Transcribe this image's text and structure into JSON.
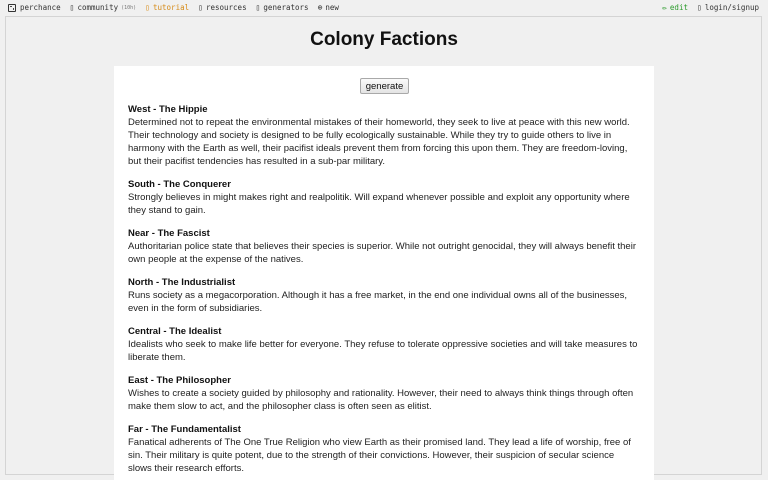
{
  "nav": {
    "site": "perchance",
    "community": "community",
    "community_count": "(10h)",
    "tutorial": "tutorial",
    "resources": "resources",
    "generators": "generators",
    "new": "new",
    "edit": "edit",
    "login": "login/signup"
  },
  "page": {
    "title": "Colony Factions",
    "generate_label": "generate"
  },
  "factions": [
    {
      "name": "West - The Hippie",
      "desc": "Determined not to repeat the environmental mistakes of their homeworld, they seek to live at peace with this new world. Their technology and society is designed to be fully ecologically sustainable. While they try to guide others to live in harmony with the Earth as well, their pacifist ideals prevent them from forcing this upon them. They are freedom-loving, but their pacifist tendencies has resulted in a sub-par military."
    },
    {
      "name": "South - The Conquerer",
      "desc": "Strongly believes in might makes right and realpolitik. Will expand whenever possible and exploit any opportunity where they stand to gain."
    },
    {
      "name": "Near - The Fascist",
      "desc": "Authoritarian police state that believes their species is superior. While not outright genocidal, they will always benefit their own people at the expense of the natives."
    },
    {
      "name": "North - The Industrialist",
      "desc": "Runs society as a megacorporation. Although it has a free market, in the end one individual owns all of the businesses, even in the form of subsidiaries."
    },
    {
      "name": "Central - The Idealist",
      "desc": "Idealists who seek to make life better for everyone. They refuse to tolerate oppressive societies and will take measures to liberate them."
    },
    {
      "name": "East - The Philosopher",
      "desc": "Wishes to create a society guided by philosophy and rationality. However, their need to always think things through often make them slow to act, and the philosopher class is often seen as elitist."
    },
    {
      "name": "Far - The Fundamentalist",
      "desc": "Fanatical adherents of The One True Religion who view Earth as their promised land. They lead a life of worship, free of sin. Their military is quite potent, due to the strength of their convictions. However, their suspicion of secular science slows their research efforts."
    }
  ]
}
